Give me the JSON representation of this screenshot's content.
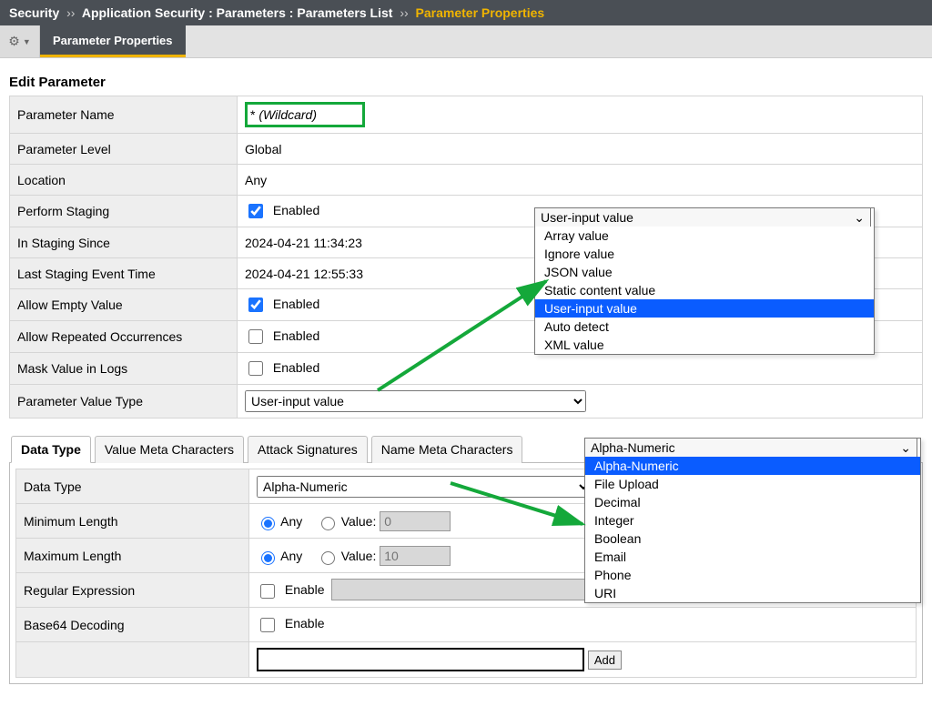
{
  "breadcrumb": {
    "root": "Security",
    "sep": "››",
    "mid": "Application Security : Parameters : Parameters List",
    "current": "Parameter Properties"
  },
  "tab_title": "Parameter Properties",
  "section_title": "Edit Parameter",
  "rows": {
    "param_name_label": "Parameter Name",
    "param_name_value_prefix": "*",
    "param_name_value_note": "(Wildcard)",
    "param_level_label": "Parameter Level",
    "param_level_value": "Global",
    "location_label": "Location",
    "location_value": "Any",
    "perform_staging_label": "Perform Staging",
    "enabled_text": "Enabled",
    "in_staging_since_label": "In Staging Since",
    "in_staging_since_value": "2024-04-21 11:34:23",
    "last_staging_label": "Last Staging Event Time",
    "last_staging_value": "2024-04-21 12:55:33",
    "allow_empty_label": "Allow Empty Value",
    "allow_repeated_label": "Allow Repeated Occurrences",
    "mask_label": "Mask Value in Logs",
    "pvt_label": "Parameter Value Type",
    "pvt_value": "User-input value"
  },
  "pvt_dropdown": {
    "selected": "User-input value",
    "options": [
      "Array value",
      "Ignore value",
      "JSON value",
      "Static content value",
      "User-input value",
      "Auto detect",
      "XML value"
    ]
  },
  "tabs": {
    "data_type": "Data Type",
    "value_meta": "Value Meta Characters",
    "attack_sig": "Attack Signatures",
    "name_meta": "Name Meta Characters"
  },
  "dt_panel": {
    "data_type_label": "Data Type",
    "data_type_value": "Alpha-Numeric",
    "min_label": "Minimum Length",
    "max_label": "Maximum Length",
    "any_text": "Any",
    "value_text": "Value:",
    "min_placeholder": "0",
    "max_placeholder": "10",
    "regex_label": "Regular Expression",
    "enable_text": "Enable",
    "base64_label": "Base64 Decoding",
    "add_text": "Add"
  },
  "dt_dropdown": {
    "selected": "Alpha-Numeric",
    "options": [
      "Alpha-Numeric",
      "File Upload",
      "Decimal",
      "Integer",
      "Boolean",
      "Email",
      "Phone",
      "URI"
    ]
  },
  "chart_data": null
}
